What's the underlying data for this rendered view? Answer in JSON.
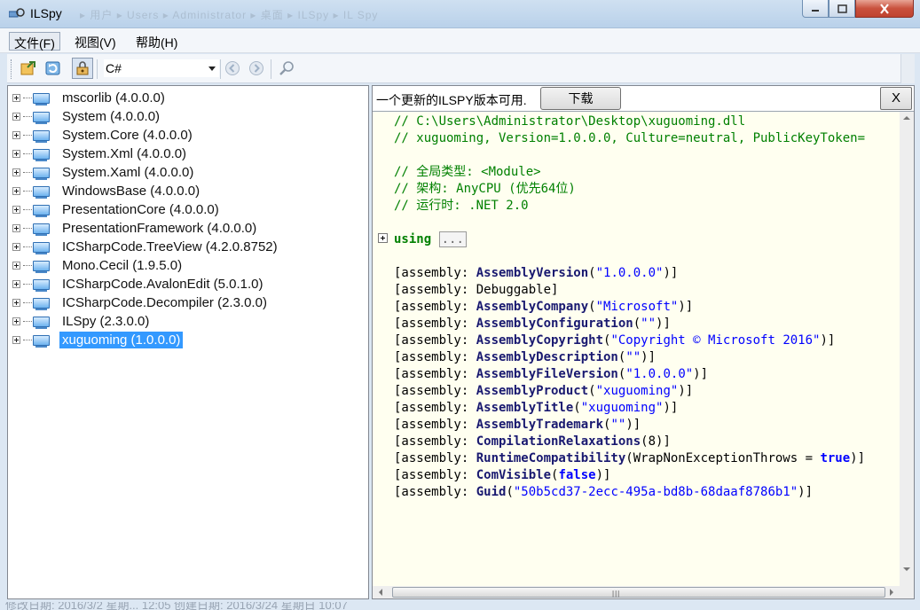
{
  "window": {
    "title": "ILSpy",
    "breadcrumb_ghost": "▸ 用户 ▸ Users ▸ Administrator ▸ 桌面 ▸ ILSpy ▸ IL Spy"
  },
  "menu": {
    "items": [
      {
        "label": "文件(F)",
        "active": true
      },
      {
        "label": "视图(V)",
        "active": false
      },
      {
        "label": "帮助(H)",
        "active": false
      }
    ]
  },
  "toolbar": {
    "language": "C#",
    "icons": [
      "open-icon",
      "reload-icon",
      "show-internal-icon",
      "back-icon",
      "forward-icon",
      "search-icon"
    ]
  },
  "tree": {
    "items": [
      {
        "label": "mscorlib (4.0.0.0)"
      },
      {
        "label": "System (4.0.0.0)"
      },
      {
        "label": "System.Core (4.0.0.0)"
      },
      {
        "label": "System.Xml (4.0.0.0)"
      },
      {
        "label": "System.Xaml (4.0.0.0)"
      },
      {
        "label": "WindowsBase (4.0.0.0)"
      },
      {
        "label": "PresentationCore (4.0.0.0)"
      },
      {
        "label": "PresentationFramework (4.0.0.0)"
      },
      {
        "label": "ICSharpCode.TreeView (4.2.0.8752)"
      },
      {
        "label": "Mono.Cecil (1.9.5.0)"
      },
      {
        "label": "ICSharpCode.AvalonEdit (5.0.1.0)"
      },
      {
        "label": "ICSharpCode.Decompiler (2.3.0.0)"
      },
      {
        "label": "ILSpy (2.3.0.0)"
      },
      {
        "label": "xuguoming (1.0.0.0)",
        "selected": true
      }
    ]
  },
  "update_bar": {
    "message": "一个更新的ILSPY版本可用.",
    "download_label": "下载",
    "close_label": "X"
  },
  "code": {
    "header_comments": [
      "// C:\\Users\\Administrator\\Desktop\\xuguoming.dll",
      "// xuguoming, Version=1.0.0.0, Culture=neutral, PublicKeyToken=",
      "// 全局类型: <Module>",
      "// 架构: AnyCPU (优先64位)",
      "// 运行时: .NET 2.0"
    ],
    "using_keyword": "using",
    "using_fold": "...",
    "prefix": "[assembly: ",
    "attributes": [
      {
        "name": "AssemblyVersion",
        "open": "(",
        "arg": "\"1.0.0.0\"",
        "arg_type": "str",
        "close": ")]"
      },
      {
        "name": "Debuggable",
        "open": "",
        "arg": "",
        "arg_type": "plain",
        "close": "]",
        "plain": true
      },
      {
        "name": "AssemblyCompany",
        "open": "(",
        "arg": "\"Microsoft\"",
        "arg_type": "str",
        "close": ")]"
      },
      {
        "name": "AssemblyConfiguration",
        "open": "(",
        "arg": "\"\"",
        "arg_type": "str",
        "close": ")]"
      },
      {
        "name": "AssemblyCopyright",
        "open": "(",
        "arg": "\"Copyright © Microsoft 2016\"",
        "arg_type": "str",
        "close": ")]"
      },
      {
        "name": "AssemblyDescription",
        "open": "(",
        "arg": "\"\"",
        "arg_type": "str",
        "close": ")]"
      },
      {
        "name": "AssemblyFileVersion",
        "open": "(",
        "arg": "\"1.0.0.0\"",
        "arg_type": "str",
        "close": ")]"
      },
      {
        "name": "AssemblyProduct",
        "open": "(",
        "arg": "\"xuguoming\"",
        "arg_type": "str",
        "close": ")]"
      },
      {
        "name": "AssemblyTitle",
        "open": "(",
        "arg": "\"xuguoming\"",
        "arg_type": "str",
        "close": ")]"
      },
      {
        "name": "AssemblyTrademark",
        "open": "(",
        "arg": "\"\"",
        "arg_type": "str",
        "close": ")]"
      },
      {
        "name": "CompilationRelaxations",
        "open": "(",
        "arg": "8",
        "arg_type": "plain",
        "close": ")]"
      },
      {
        "name": "RuntimeCompatibility",
        "open": "(",
        "arg": "WrapNonExceptionThrows = ",
        "arg_type": "plain",
        "arg2": "true",
        "close": ")]"
      },
      {
        "name": "ComVisible",
        "open": "(",
        "arg": "false",
        "arg_type": "kw",
        "close": ")]"
      },
      {
        "name": "Guid",
        "open": "(",
        "arg": "\"50b5cd37-2ecc-495a-bd8b-68daaf8786b1\"",
        "arg_type": "str",
        "close": ")]"
      }
    ]
  },
  "status_fragment": "修改日期: 2016/3/2 星期... 12:05 创建日期: 2016/3/24 星期日 10:07",
  "colors": {
    "selection": "#3399ff",
    "code_background": "#fffff0",
    "comment": "#008000",
    "string": "#0000ff",
    "attribute": "#191970"
  }
}
